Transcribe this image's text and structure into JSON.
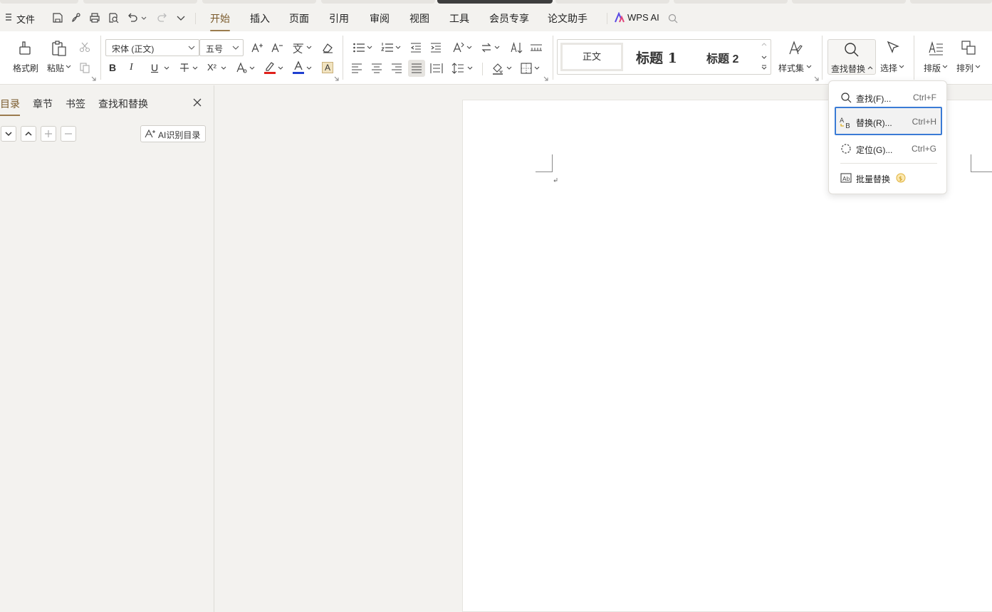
{
  "menubar": {
    "file_label": "文件",
    "tabs": [
      "开始",
      "插入",
      "页面",
      "引用",
      "审阅",
      "视图",
      "工具",
      "会员专享",
      "论文助手"
    ],
    "active_tab": "开始",
    "wps_ai": "WPS AI"
  },
  "ribbon": {
    "format_painter": "格式刷",
    "paste": "粘贴",
    "font_name": "宋体 (正文)",
    "font_size": "五号",
    "styles": [
      "正文",
      "标题 1",
      "标题 2"
    ],
    "style_set": "样式集",
    "find_replace": "查找替换",
    "select": "选择",
    "layout": "排版",
    "arrange": "排列",
    "bold_glyph": "B",
    "italic_glyph": "I",
    "underline_glyph": "U",
    "superscript_glyph": "X²",
    "char_shade_glyph": "A",
    "font_color_glyph": "A",
    "highlight_color": "#e0201b",
    "font_color": "#1f3fd0"
  },
  "leftpanel": {
    "tabs": [
      "目录",
      "章节",
      "书签",
      "查找和替换"
    ],
    "active_tab": "目录",
    "ai_toc_button": "AI识别目录"
  },
  "dropdown": {
    "items": [
      {
        "label": "查找(F)...",
        "shortcut": "Ctrl+F",
        "icon": "search-icon"
      },
      {
        "label": "替换(R)...",
        "shortcut": "Ctrl+H",
        "icon": "replace-icon",
        "highlighted": true
      },
      {
        "label": "定位(G)...",
        "shortcut": "Ctrl+G",
        "icon": "goto-icon"
      },
      {
        "label": "批量替换",
        "shortcut": "",
        "icon": "batch-replace-icon"
      }
    ]
  },
  "colors": {
    "accent": "#9b7b4d",
    "highlight_border": "#3a7bd5"
  }
}
